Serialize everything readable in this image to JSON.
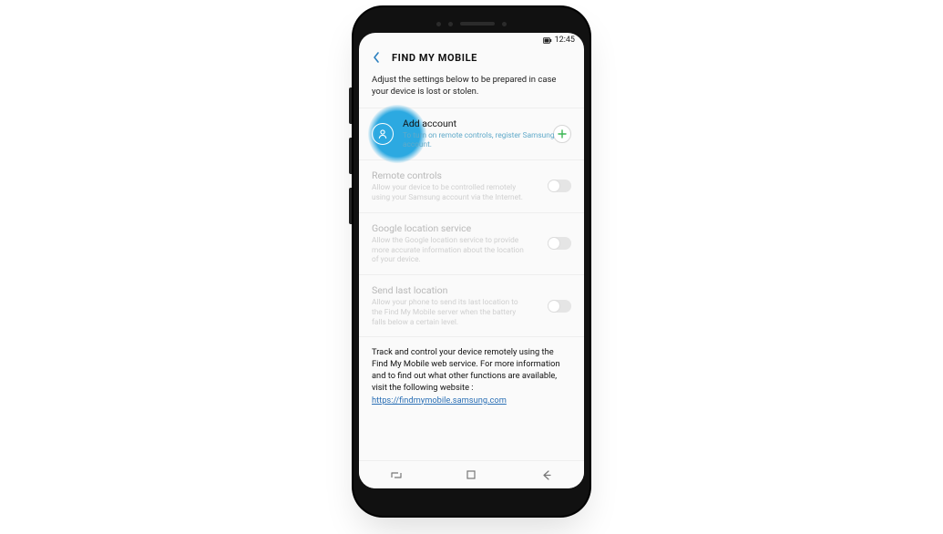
{
  "status": {
    "time": "12:45"
  },
  "header": {
    "title": "FIND MY MOBILE"
  },
  "intro": "Adjust the settings below to be prepared in case your device is lost or stolen.",
  "add_account": {
    "title": "Add account",
    "desc": "To turn on remote controls, register Samsung account."
  },
  "items": [
    {
      "title": "Remote controls",
      "desc": "Allow your device to be controlled remotely using your Samsung account via the Internet."
    },
    {
      "title": "Google location service",
      "desc": "Allow the Google location service to provide more accurate information about the location of your device."
    },
    {
      "title": "Send last location",
      "desc": "Allow your phone to send its last location to the Find My Mobile server when the battery falls below a certain level."
    }
  ],
  "footer": {
    "text": "Track and control your device remotely using the Find My Mobile web service. For more information and to find out what other functions are available, visit the following website :",
    "link": "https://findmymobile.samsung.com"
  }
}
